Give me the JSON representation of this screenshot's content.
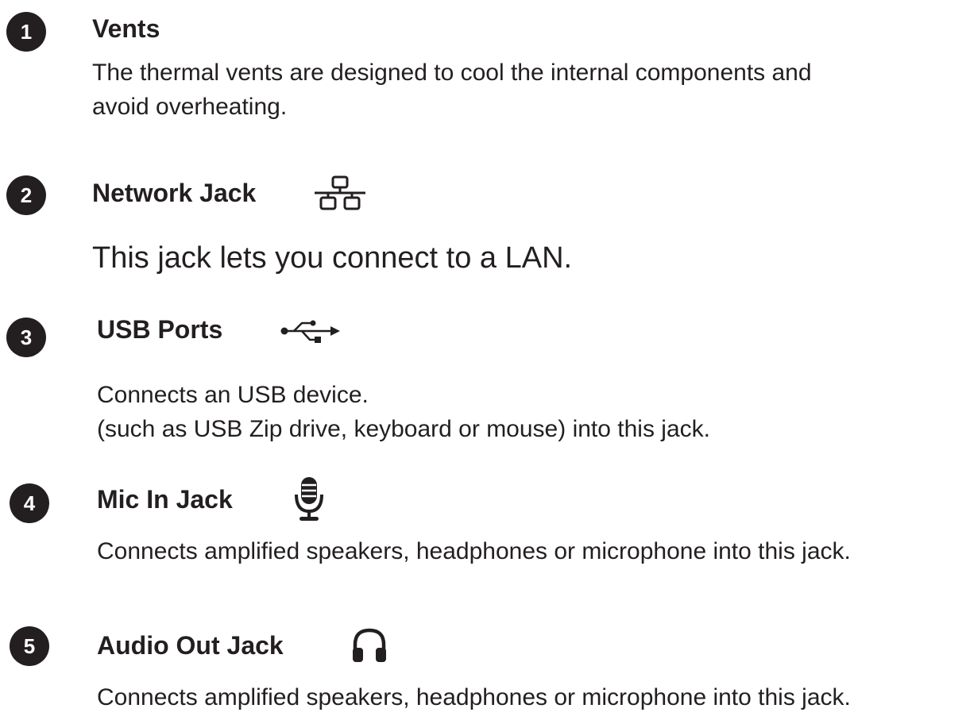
{
  "sections": [
    {
      "number": "1",
      "title": "Vents",
      "lines": [
        "The thermal vents are designed to cool the internal components and",
        "avoid overheating."
      ]
    },
    {
      "number": "2",
      "title": "Network Jack",
      "icon": "network-icon",
      "lines": [
        "This jack lets you connect to a LAN."
      ]
    },
    {
      "number": "3",
      "title": "USB Ports",
      "icon": "usb-icon",
      "lines": [
        "Connects an USB device.",
        "(such as USB Zip drive, keyboard or mouse) into this jack."
      ]
    },
    {
      "number": "4",
      "title": "Mic In Jack",
      "icon": "microphone-icon",
      "lines": [
        "Connects amplified speakers, headphones or microphone into this jack."
      ]
    },
    {
      "number": "5",
      "title": "Audio Out Jack",
      "icon": "headphones-icon",
      "lines": [
        "Connects amplified speakers, headphones or microphone into this jack."
      ]
    }
  ],
  "colors": {
    "text": "#231f20",
    "badge_bg": "#231f20",
    "badge_text": "#ffffff"
  }
}
